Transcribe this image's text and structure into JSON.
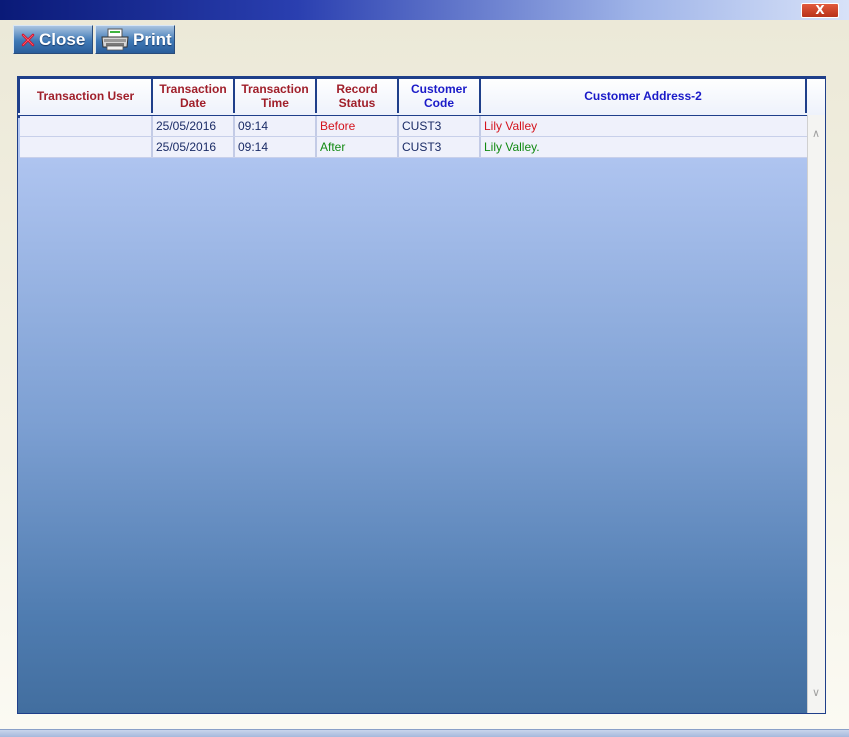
{
  "window": {
    "close_label": "X"
  },
  "toolbar": {
    "close_label": "Close",
    "print_label": "Print"
  },
  "grid": {
    "columns": [
      {
        "label": "Transaction User",
        "color": "#a01f2a"
      },
      {
        "label": "Transaction Date",
        "color": "#a01f2a"
      },
      {
        "label": "Transaction Time",
        "color": "#a01f2a"
      },
      {
        "label": "Record Status",
        "color": "#a01f2a"
      },
      {
        "label": "Customer Code",
        "color": "#1a1ac8"
      },
      {
        "label": "Customer Address-2",
        "color": "#1a1ac8"
      }
    ],
    "rows": [
      {
        "user": "",
        "date": "25/05/2016",
        "time": "09:14",
        "status": "Before",
        "code": "CUST3",
        "address": "Lily Valley"
      },
      {
        "user": "",
        "date": "25/05/2016",
        "time": "09:14",
        "status": "After",
        "code": "CUST3",
        "address": "Lily Valley."
      }
    ]
  },
  "colors": {
    "before": "#d4141e",
    "after": "#128a12"
  }
}
